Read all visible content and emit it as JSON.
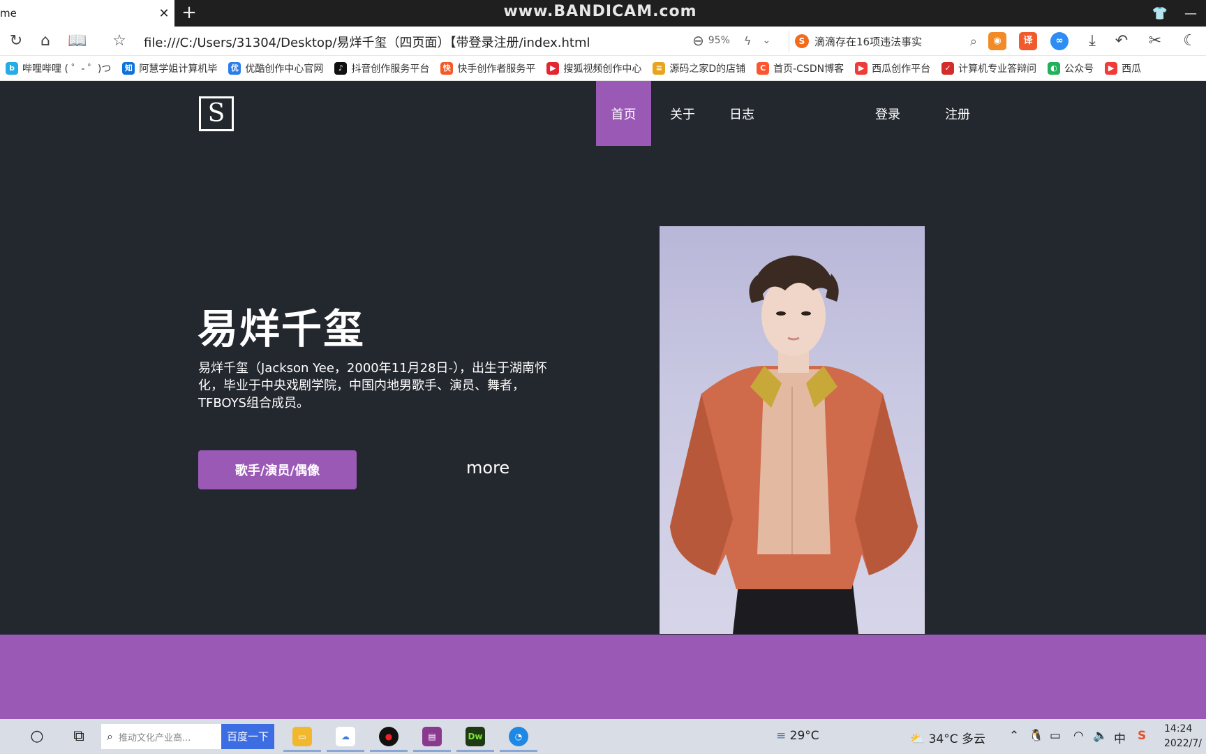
{
  "browser": {
    "tab_title": "me",
    "watermark": "www.BANDICAM.com",
    "url": "file:///C:/Users/31304/Desktop/易烊千玺（四页面）【带登录注册/index.html",
    "zoom": "95%",
    "search_text": "滴滴存在16项违法事实",
    "bookmarks": [
      {
        "label": "哔哩哔哩 ( ゜- ゜)つ",
        "color": "#23ade5",
        "glyph": "b"
      },
      {
        "label": "阿慧学姐计算机毕",
        "color": "#0e72d9",
        "glyph": "知"
      },
      {
        "label": "优酷创作中心官网",
        "color": "#2b7de9",
        "glyph": "优"
      },
      {
        "label": "抖音创作服务平台",
        "color": "#111111",
        "glyph": "♪"
      },
      {
        "label": "快手创作者服务平",
        "color": "#f45a27",
        "glyph": "快"
      },
      {
        "label": "搜狐视频创作中心",
        "color": "#e3262f",
        "glyph": "▶"
      },
      {
        "label": "源码之家D的店铺",
        "color": "#e8a41c",
        "glyph": "≡"
      },
      {
        "label": "首页-CSDN博客",
        "color": "#fc5531",
        "glyph": "C"
      },
      {
        "label": "西瓜创作平台",
        "color": "#f03b36",
        "glyph": "▶"
      },
      {
        "label": "计算机专业答辩问",
        "color": "#d42b2b",
        "glyph": "✓"
      },
      {
        "label": "公众号",
        "color": "#21b15b",
        "glyph": "◐"
      },
      {
        "label": "西瓜",
        "color": "#f03b36",
        "glyph": "▶"
      }
    ]
  },
  "site": {
    "logo": "S",
    "nav": {
      "home": "首页",
      "about": "关于",
      "journal": "日志",
      "login": "登录",
      "register": "注册"
    },
    "hero": {
      "title": "易烊千玺",
      "description": "易烊千玺（Jackson Yee，2000年11月28日-），出生于湖南怀化，毕业于中央戏剧学院，中国内地男歌手、演员、舞者，TFBOYS组合成员。",
      "cta": "歌手/演员/偶像",
      "more": "more"
    },
    "accent": "#9b59b6",
    "background": "#23272e"
  },
  "taskbar": {
    "search_placeholder": "推动文化产业高...",
    "search_button": "百度一下",
    "weather_small": "29°C",
    "weather_main": "34°C 多云",
    "ime": "中",
    "time": "14:24",
    "date": "2022/7/"
  }
}
